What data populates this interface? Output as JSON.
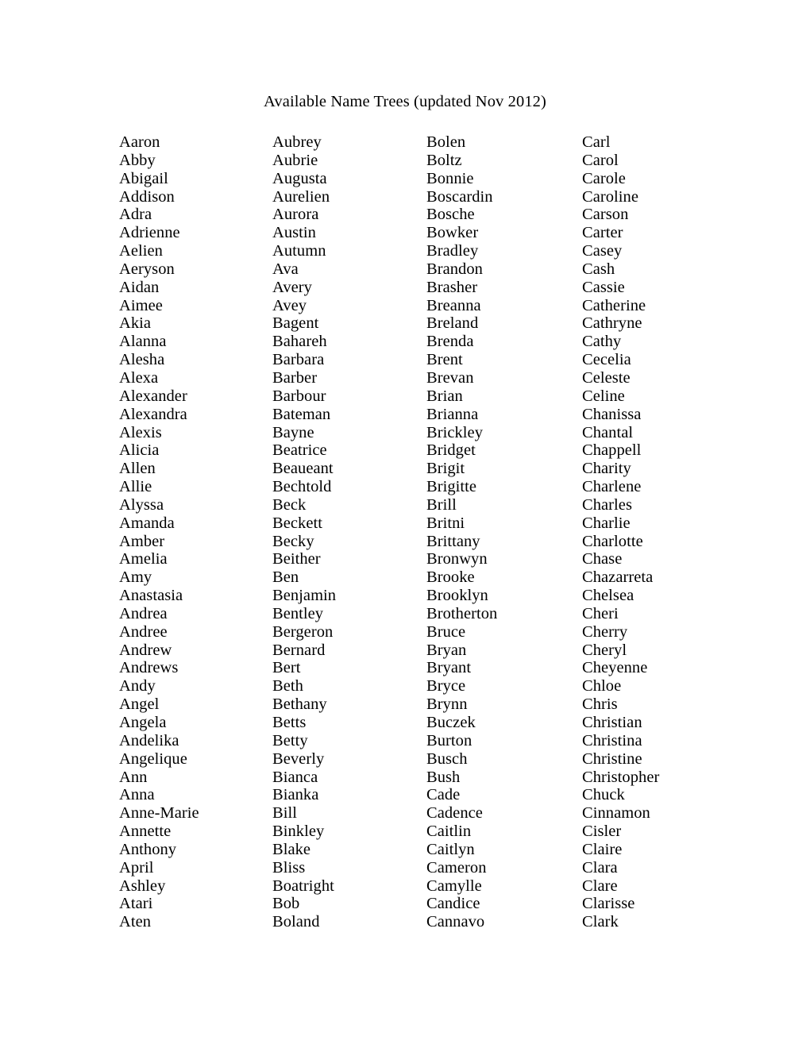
{
  "document": {
    "title": "Available Name Trees (updated Nov 2012)",
    "rows_per_column": 44,
    "columns": [
      {
        "name": "column-1",
        "names": [
          "Aaron",
          "Abby",
          "Abigail",
          "Addison",
          "Adra",
          "Adrienne",
          "Aelien",
          "Aeryson",
          "Aidan",
          "Aimee",
          "Akia",
          "Alanna",
          "Alesha",
          "Alexa",
          "Alexander",
          "Alexandra",
          "Alexis",
          "Alicia",
          "Allen",
          "Allie",
          "Alyssa",
          "Amanda",
          "Amber",
          "Amelia",
          "Amy",
          "Anastasia",
          "Andrea",
          "Andree",
          "Andrew",
          "Andrews",
          "Andy",
          "Angel",
          "Angela",
          "Andelika",
          "Angelique",
          "Ann",
          "Anna",
          "Anne-Marie",
          "Annette",
          "Anthony",
          "April",
          "Ashley",
          "Atari",
          "Aten"
        ]
      },
      {
        "name": "column-2",
        "names": [
          "Aubrey",
          "Aubrie",
          "Augusta",
          "Aurelien",
          "Aurora",
          "Austin",
          "Autumn",
          "Ava",
          "Avery",
          "Avey",
          "Bagent",
          "Bahareh",
          "Barbara",
          "Barber",
          "Barbour",
          "Bateman",
          "Bayne",
          "Beatrice",
          "Beaueant",
          "Bechtold",
          "Beck",
          "Beckett",
          "Becky",
          "Beither",
          "Ben",
          "Benjamin",
          "Bentley",
          "Bergeron",
          "Bernard",
          "Bert",
          "Beth",
          "Bethany",
          "Betts",
          "Betty",
          "Beverly",
          "Bianca",
          "Bianka",
          "Bill",
          "Binkley",
          "Blake",
          "Bliss",
          "Boatright",
          "Bob",
          "Boland"
        ]
      },
      {
        "name": "column-3",
        "names": [
          "Bolen",
          "Boltz",
          "Bonnie",
          "Boscardin",
          "Bosche",
          "Bowker",
          "Bradley",
          "Brandon",
          "Brasher",
          "Breanna",
          "Breland",
          "Brenda",
          "Brent",
          "Brevan",
          "Brian",
          "Brianna",
          "Brickley",
          "Bridget",
          "Brigit",
          "Brigitte",
          "Brill",
          "Britni",
          "Brittany",
          "Bronwyn",
          "Brooke",
          "Brooklyn",
          "Brotherton",
          "Bruce",
          "Bryan",
          "Bryant",
          "Bryce",
          "Brynn",
          "Buczek",
          "Burton",
          "Busch",
          "Bush",
          "Cade",
          "Cadence",
          "Caitlin",
          "Caitlyn",
          "Cameron",
          "Camylle",
          "Candice",
          "Cannavo"
        ]
      },
      {
        "name": "column-4",
        "names": [
          "Carl",
          "Carol",
          "Carole",
          "Caroline",
          "Carson",
          "Carter",
          "Casey",
          "Cash",
          "Cassie",
          "Catherine",
          "Cathryne",
          "Cathy",
          "Cecelia",
          "Celeste",
          "Celine",
          "Chanissa",
          "Chantal",
          "Chappell",
          "Charity",
          "Charlene",
          "Charles",
          "Charlie",
          "Charlotte",
          "Chase",
          "Chazarreta",
          "Chelsea",
          "Cheri",
          "Cherry",
          "Cheryl",
          "Cheyenne",
          "Chloe",
          "Chris",
          "Christian",
          "Christina",
          "Christine",
          "Christopher",
          "Chuck",
          "Cinnamon",
          "Cisler",
          "Claire",
          "Clara",
          "Clare",
          "Clarisse",
          "Clark"
        ]
      }
    ]
  }
}
